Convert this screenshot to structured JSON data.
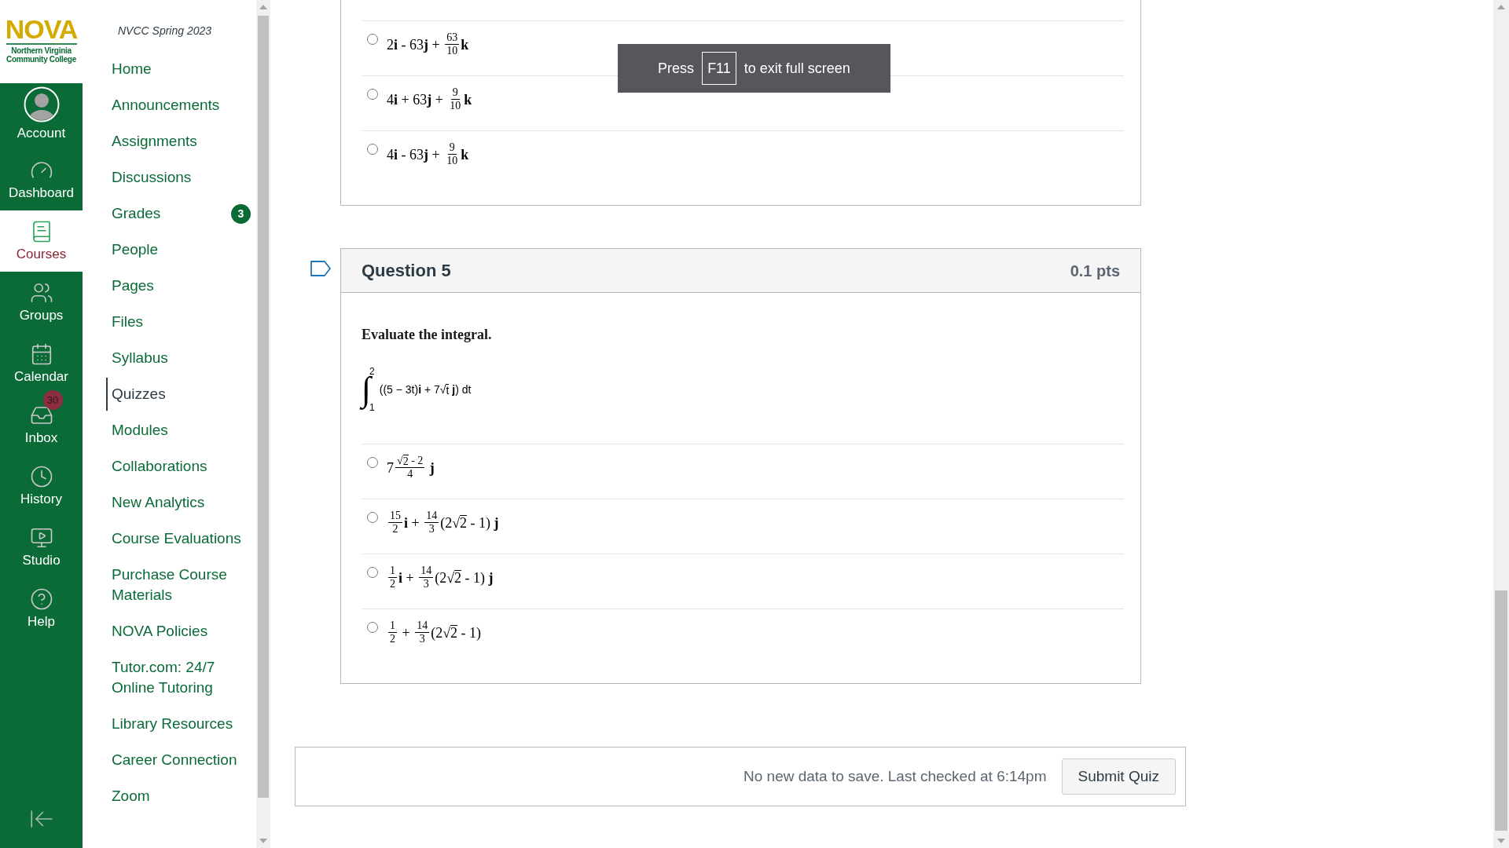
{
  "logo": {
    "wordmark": "NOVA",
    "subtitle_lines": [
      "Northern Virginia",
      "Community College"
    ]
  },
  "global_nav": [
    {
      "label": "Account",
      "kind": "avatar",
      "selected": false
    },
    {
      "label": "Dashboard",
      "kind": "dashboard",
      "selected": false
    },
    {
      "label": "Courses",
      "kind": "courses",
      "selected": true
    },
    {
      "label": "Groups",
      "kind": "groups",
      "selected": false
    },
    {
      "label": "Calendar",
      "kind": "calendar",
      "selected": false
    },
    {
      "label": "Inbox",
      "kind": "inbox",
      "selected": false,
      "badge": "30"
    },
    {
      "label": "History",
      "kind": "history",
      "selected": false
    },
    {
      "label": "Studio",
      "kind": "studio",
      "selected": false
    },
    {
      "label": "Help",
      "kind": "help",
      "selected": false
    }
  ],
  "course_nav": {
    "title": "NVCC Spring 2023",
    "items": [
      {
        "label": "Home",
        "selected": false
      },
      {
        "label": "Announcements",
        "selected": false
      },
      {
        "label": "Assignments",
        "selected": false
      },
      {
        "label": "Discussions",
        "selected": false
      },
      {
        "label": "Grades",
        "selected": false,
        "badge": "3"
      },
      {
        "label": "People",
        "selected": false
      },
      {
        "label": "Pages",
        "selected": false
      },
      {
        "label": "Files",
        "selected": false
      },
      {
        "label": "Syllabus",
        "selected": false
      },
      {
        "label": "Quizzes",
        "selected": true
      },
      {
        "label": "Modules",
        "selected": false
      },
      {
        "label": "Collaborations",
        "selected": false
      },
      {
        "label": "New Analytics",
        "selected": false
      },
      {
        "label": "Course Evaluations",
        "selected": false
      },
      {
        "label": "Purchase Course Materials",
        "selected": false
      },
      {
        "label": "NOVA Policies",
        "selected": false
      },
      {
        "label": "Tutor.com: 24/7 Online Tutoring",
        "selected": false
      },
      {
        "label": "Library Resources",
        "selected": false
      },
      {
        "label": "Career Connection",
        "selected": false
      },
      {
        "label": "Zoom",
        "selected": false
      }
    ]
  },
  "fullscreen_notice": {
    "before": "Press",
    "key": "F11",
    "after": "to exit full screen"
  },
  "question_4": {
    "answers": [
      {
        "selected": false,
        "math": [
          {
            "kind": "text",
            "text": "2**i** - 63**j** + "
          },
          {
            "kind": "frac",
            "num": "63",
            "den": "10"
          },
          {
            "kind": "text",
            "text": "**k**"
          }
        ]
      },
      {
        "selected": false,
        "math": [
          {
            "kind": "text",
            "text": "4**i** + 63**j** + "
          },
          {
            "kind": "frac",
            "num": "9",
            "den": "10"
          },
          {
            "kind": "text",
            "text": "**k**"
          }
        ]
      },
      {
        "selected": false,
        "math": [
          {
            "kind": "text",
            "text": "4**i** - 63**j** + "
          },
          {
            "kind": "frac",
            "num": "9",
            "den": "10"
          },
          {
            "kind": "text",
            "text": "**k**"
          }
        ]
      }
    ]
  },
  "question_5": {
    "title": "Question 5",
    "points": "0.1 pts",
    "bookmarked": false,
    "prompt": "Evaluate the integral.",
    "integral": {
      "symbol": "∫",
      "upper": "2",
      "lower": "1",
      "integrand": [
        {
          "kind": "text",
          "text": "((5 − 3t)**i** + 7"
        },
        {
          "kind": "sqrt",
          "sign": "√",
          "radicand": "t"
        },
        {
          "kind": "text",
          "text": " **j**) dt"
        }
      ]
    },
    "answers": [
      {
        "selected": false,
        "math": [
          {
            "kind": "text",
            "text": "7"
          },
          {
            "kind": "frac",
            "num": [
              {
                "kind": "sqrt",
                "sign": "√",
                "radicand": "2"
              },
              {
                "kind": "text",
                "text": " - 2"
              }
            ],
            "den": "4"
          },
          {
            "kind": "text",
            "text": " **j**"
          }
        ]
      },
      {
        "selected": false,
        "math": [
          {
            "kind": "frac",
            "num": "15",
            "den": "2"
          },
          {
            "kind": "text",
            "text": "**i** + "
          },
          {
            "kind": "frac",
            "num": "14",
            "den": "3"
          },
          {
            "kind": "text",
            "text": "(2"
          },
          {
            "kind": "sqrt",
            "sign": "√",
            "radicand": "2"
          },
          {
            "kind": "text",
            "text": " - 1) **j**"
          }
        ]
      },
      {
        "selected": false,
        "math": [
          {
            "kind": "frac",
            "num": "1",
            "den": "2"
          },
          {
            "kind": "text",
            "text": "**i** + "
          },
          {
            "kind": "frac",
            "num": "14",
            "den": "3"
          },
          {
            "kind": "text",
            "text": "(2"
          },
          {
            "kind": "sqrt",
            "sign": "√",
            "radicand": "2"
          },
          {
            "kind": "text",
            "text": " - 1) **j**"
          }
        ]
      },
      {
        "selected": false,
        "math": [
          {
            "kind": "frac",
            "num": "1",
            "den": "2"
          },
          {
            "kind": "text",
            "text": " + "
          },
          {
            "kind": "frac",
            "num": "14",
            "den": "3"
          },
          {
            "kind": "text",
            "text": "(2"
          },
          {
            "kind": "sqrt",
            "sign": "√",
            "radicand": "2"
          },
          {
            "kind": "text",
            "text": " - 1)"
          }
        ]
      }
    ]
  },
  "footer": {
    "status": "No new data to save. Last checked at 6:14pm",
    "submit_button": "Submit Quiz"
  }
}
